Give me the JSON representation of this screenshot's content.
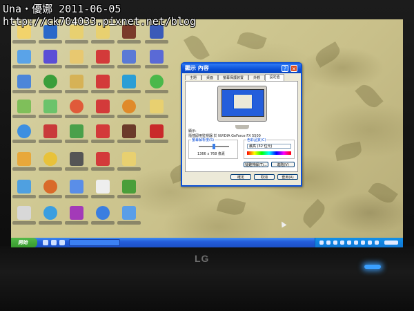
{
  "watermark": {
    "title": "Una・優娜  2011-06-05",
    "url": "http://ck704033.pixnet.net/blog"
  },
  "monitor": {
    "brand": "LG",
    "led_color": "#3aa0ff"
  },
  "dialog": {
    "title": "顯示 內容",
    "tabs": [
      "主題",
      "桌面",
      "螢幕保護裝置",
      "外觀",
      "設定值"
    ],
    "active_tab": "設定值",
    "display_label": "顯示:",
    "display_value": "隨插即用監視器 於 NVIDIA GeForce FX 5500",
    "resolution_group": "螢幕解析度(S)",
    "resolution_value": "1366 x 768 像素",
    "color_group": "色彩品質(C)",
    "color_value": "最高 (32 位元)",
    "buttons": {
      "troubleshoot": "疑難排解(T)...",
      "advanced": "進階(V)",
      "ok": "確定",
      "cancel": "取消",
      "apply": "套用(A)"
    }
  },
  "taskbar": {
    "start_label": "開始"
  },
  "colors": {
    "xp_blue": "#245edb",
    "start_green": "#379a2e",
    "dialog_bg": "#ece9d8"
  }
}
